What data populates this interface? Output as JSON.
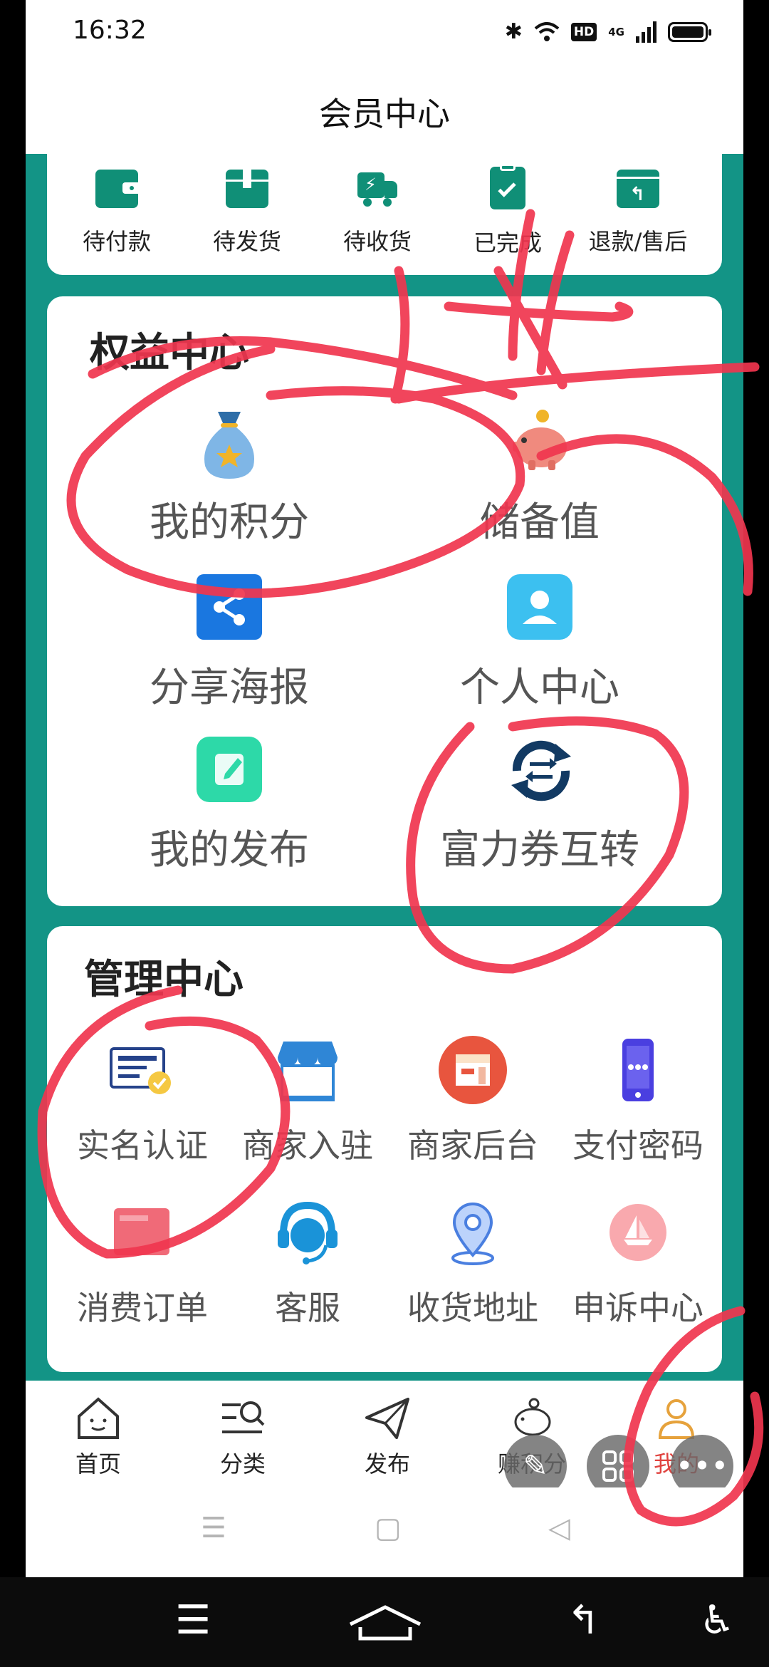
{
  "status_bar": {
    "time": "16:32",
    "hd": "HD",
    "network": "4G"
  },
  "title_bar": {
    "title": "会员中心"
  },
  "order_bar": {
    "items": [
      {
        "label": "待付款",
        "icon": "wallet-icon"
      },
      {
        "label": "待发货",
        "icon": "package-icon"
      },
      {
        "label": "待收货",
        "icon": "delivery-truck-icon"
      },
      {
        "label": "已完成",
        "icon": "clipboard-check-icon"
      },
      {
        "label": "退款/售后",
        "icon": "return-box-icon"
      }
    ]
  },
  "benefits": {
    "title": "权益中心",
    "items": [
      {
        "label": "我的积分",
        "icon": "money-bag-icon"
      },
      {
        "label": "储备值",
        "icon": "piggy-bank-icon"
      },
      {
        "label": "分享海报",
        "icon": "share-icon"
      },
      {
        "label": "个人中心",
        "icon": "person-icon"
      },
      {
        "label": "我的发布",
        "icon": "edit-note-icon"
      },
      {
        "label": "富力券互转",
        "icon": "exchange-icon"
      }
    ]
  },
  "management": {
    "title": "管理中心",
    "items": [
      {
        "label": "实名认证",
        "icon": "id-card-check-icon"
      },
      {
        "label": "商家入驻",
        "icon": "storefront-icon"
      },
      {
        "label": "商家后台",
        "icon": "shop-dashboard-icon"
      },
      {
        "label": "支付密码",
        "icon": "phone-password-icon"
      },
      {
        "label": "消费订单",
        "icon": "receipt-icon"
      },
      {
        "label": "客服",
        "icon": "headset-agent-icon"
      },
      {
        "label": "收货地址",
        "icon": "location-pin-icon"
      },
      {
        "label": "申诉中心",
        "icon": "appeal-icon"
      }
    ]
  },
  "bottom_nav": {
    "items": [
      {
        "label": "首页",
        "icon": "home-icon"
      },
      {
        "label": "分类",
        "icon": "category-search-icon"
      },
      {
        "label": "发布",
        "icon": "paper-plane-icon"
      },
      {
        "label": "赚积分",
        "icon": "piggy-icon"
      },
      {
        "label": "我的",
        "icon": "user-icon"
      }
    ],
    "active_index": 4
  },
  "colors": {
    "teal_background": "#139486",
    "icon_green": "#108f77",
    "active_nav": "#e0433f",
    "annotation_red": "#f0364f"
  }
}
